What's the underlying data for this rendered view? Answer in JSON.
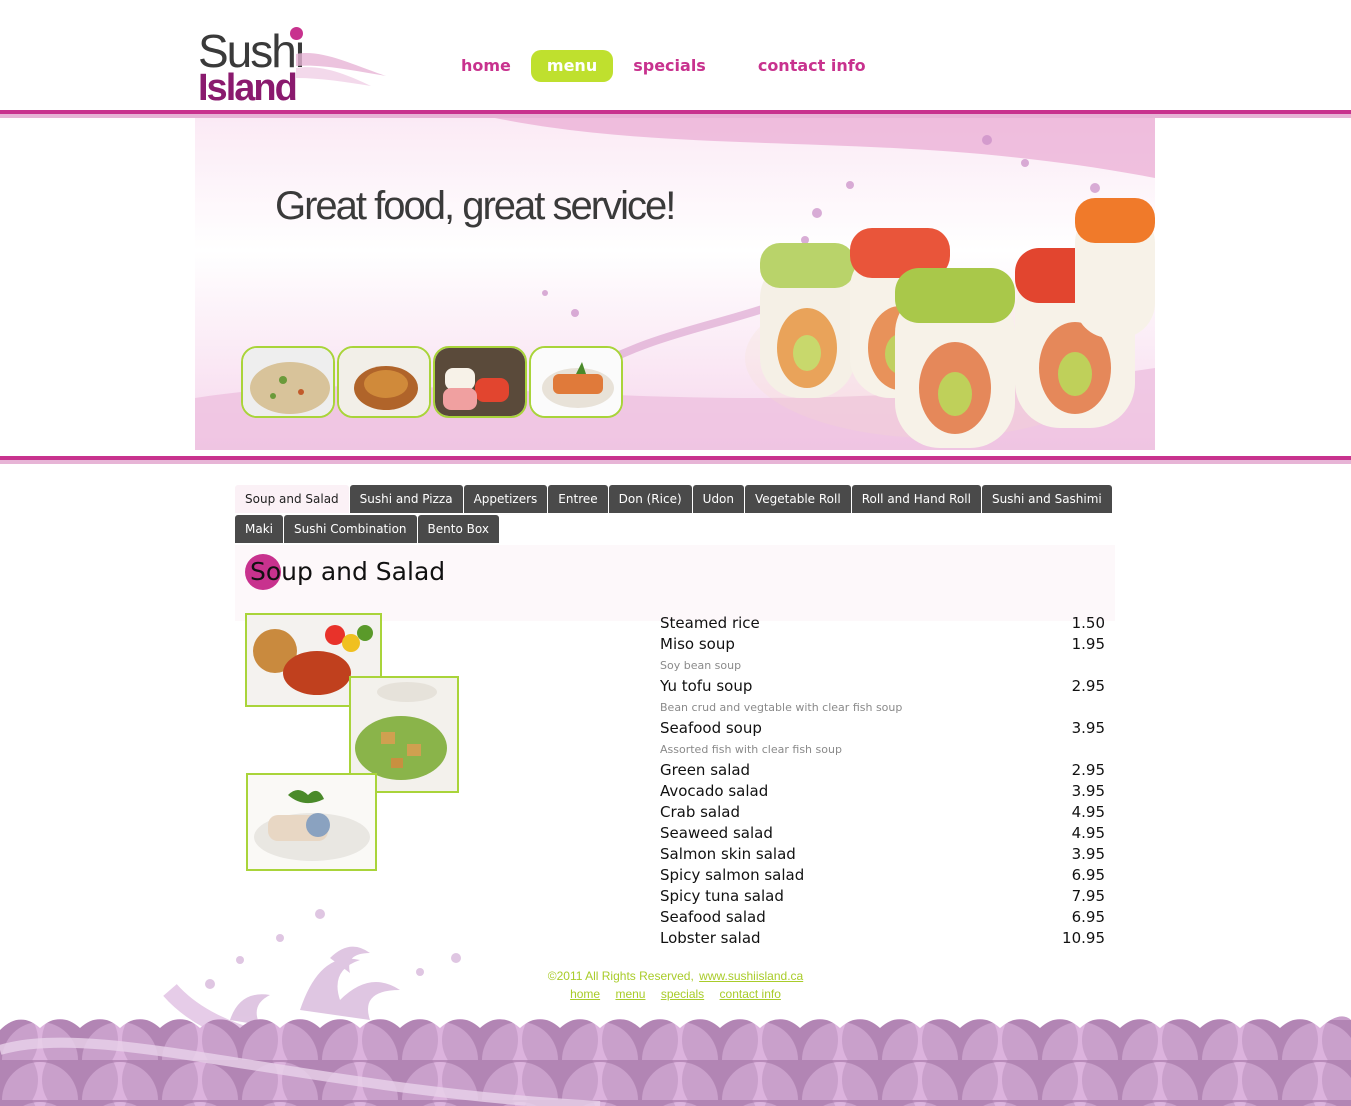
{
  "logo": {
    "line1": "Sushi",
    "line2": "Island"
  },
  "nav": [
    {
      "label": "home",
      "active": false
    },
    {
      "label": "menu",
      "active": true
    },
    {
      "label": "specials",
      "active": false
    },
    {
      "label": "contact info",
      "active": false
    }
  ],
  "banner": {
    "tagline": "Great food, great service!"
  },
  "tabs": {
    "row1": [
      "Soup and Salad",
      "Sushi and Pizza",
      "Appetizers",
      "Entree",
      "Don (Rice)",
      "Udon",
      "Vegetable Roll",
      "Roll and Hand Roll",
      "Sushi and Sashimi"
    ],
    "row2": [
      "Maki",
      "Sushi Combination",
      "Bento Box"
    ],
    "active": "Soup and Salad"
  },
  "section": {
    "title": "Soup and Salad"
  },
  "menu": [
    {
      "name": "Steamed rice",
      "price": "1.50"
    },
    {
      "name": "Miso soup",
      "price": "1.95",
      "desc": "Soy bean soup"
    },
    {
      "name": "Yu tofu soup",
      "price": "2.95",
      "desc": "Bean crud and vegtable with clear fish soup"
    },
    {
      "name": "Seafood soup",
      "price": "3.95",
      "desc": "Assorted fish with clear fish soup"
    },
    {
      "name": "Green salad",
      "price": "2.95"
    },
    {
      "name": "Avocado salad",
      "price": "3.95"
    },
    {
      "name": "Crab salad",
      "price": "4.95"
    },
    {
      "name": "Seaweed salad",
      "price": "4.95"
    },
    {
      "name": "Salmon skin salad",
      "price": "3.95"
    },
    {
      "name": "Spicy salmon salad",
      "price": "6.95"
    },
    {
      "name": "Spicy tuna salad",
      "price": "7.95"
    },
    {
      "name": "Seafood salad",
      "price": "6.95"
    },
    {
      "name": "Lobster salad",
      "price": "10.95"
    }
  ],
  "footer": {
    "copyright": "©2011 All Rights Reserved,",
    "site_link": "www.sushiisland.ca",
    "links": [
      "home",
      "menu",
      "specials",
      "contact info"
    ]
  },
  "colors": {
    "brand": "#c8328e",
    "accent": "#bfe02e",
    "dark_tab": "#4a4a4a"
  }
}
